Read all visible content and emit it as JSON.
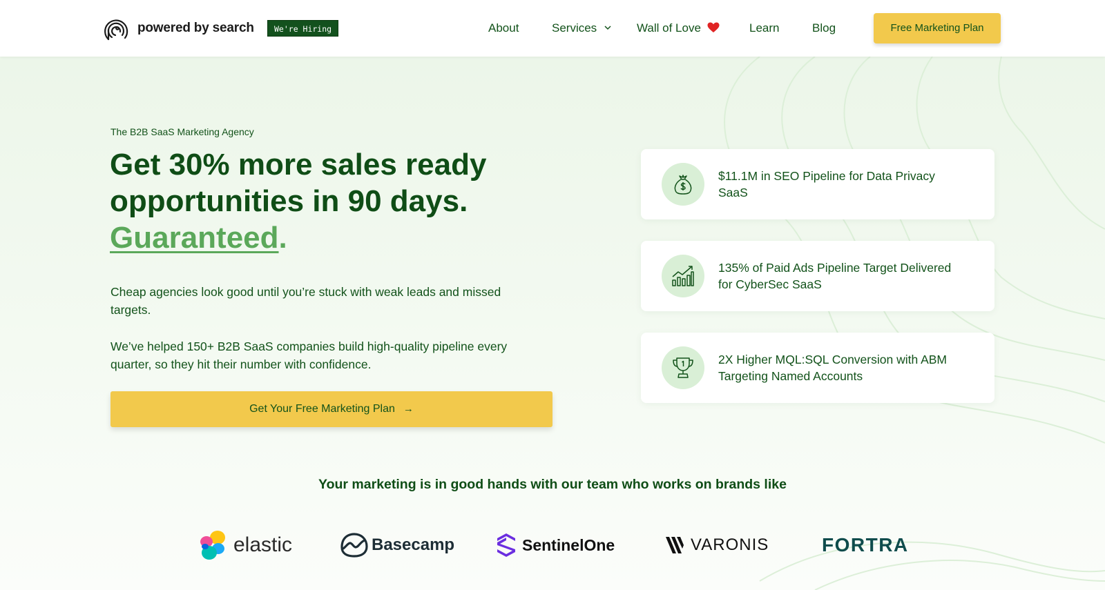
{
  "header": {
    "logo_text": "powered by search",
    "hiring_badge": "We're Hiring",
    "nav": [
      {
        "label": "About"
      },
      {
        "label": "Services"
      },
      {
        "label": "Wall of Love"
      },
      {
        "label": "Learn"
      },
      {
        "label": "Blog"
      }
    ],
    "cta": "Free Marketing Plan"
  },
  "hero": {
    "eyebrow": "The B2B SaaS Marketing Agency",
    "headline_line1": "Get 30% more sales ready",
    "headline_line2": "opportunities in 90 days.",
    "headline_highlight": "Guaranteed",
    "headline_period": ".",
    "paragraph1": "Cheap agencies look good until you’re stuck with weak leads and missed targets.",
    "paragraph2": "We’ve helped 150+ B2B SaaS companies build high-quality pipeline every quarter, so they hit their number with confidence.",
    "cta": "Get Your Free Marketing Plan",
    "cta_arrow": "→"
  },
  "results": [
    {
      "icon": "money-bag-icon",
      "text": "$11.1M in SEO Pipeline for Data Privacy SaaS"
    },
    {
      "icon": "growth-chart-icon",
      "text": "135% of Paid Ads Pipeline Target Delivered for CyberSec SaaS"
    },
    {
      "icon": "trophy-icon",
      "text": "2X Higher MQL:SQL Conversion with ABM Targeting Named Accounts"
    }
  ],
  "brands": {
    "title": "Your marketing is in good hands with our team who works on brands like",
    "items": [
      "elastic",
      "Basecamp",
      "SentinelOne",
      "VARONIS",
      "FORTRA"
    ]
  },
  "colors": {
    "brand_green": "#12521a",
    "accent_green": "#5ba85a",
    "cta_yellow": "#f2c94c",
    "hero_bg": "#ecf6e9"
  }
}
